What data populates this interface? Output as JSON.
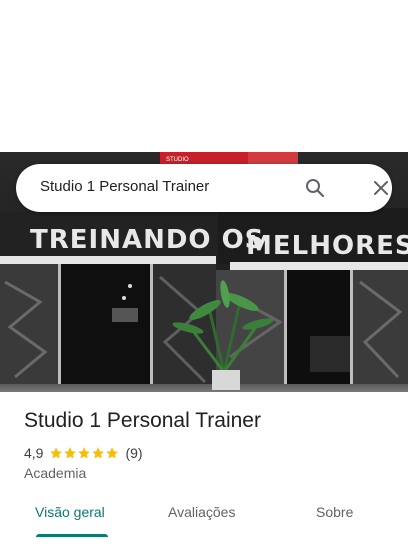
{
  "search": {
    "query": "Studio 1 Personal Trainer",
    "search_icon": "search-icon",
    "close_icon": "close-icon"
  },
  "hero": {
    "sign_small": "STUDIO",
    "sign_left": "TREINANDO OS",
    "sign_right": "MELHORES"
  },
  "place": {
    "name": "Studio 1 Personal Trainer",
    "rating": "4,9",
    "rating_stars": 5,
    "reviews": "(9)",
    "category": "Academia"
  },
  "tabs": [
    {
      "label": "Visão geral",
      "active": true
    },
    {
      "label": "Avaliações",
      "active": false
    },
    {
      "label": "Sobre",
      "active": false
    }
  ],
  "colors": {
    "accent": "#0b7a70",
    "star": "#fbbc04",
    "sign_red": "#c8202a"
  }
}
